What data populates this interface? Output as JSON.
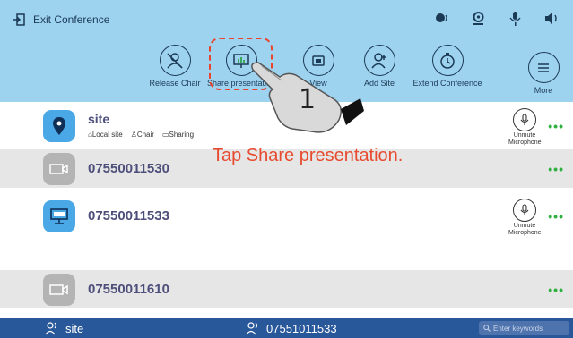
{
  "header": {
    "exit_label": "Exit Conference"
  },
  "top_icons": [
    "speaker-volume-icon",
    "camera-icon",
    "microphone-icon",
    "volume-icon"
  ],
  "toolbar": {
    "release_chair": "Release Chair",
    "share_presentation": "Share presentation",
    "view": "View",
    "add_site": "Add Site",
    "extend_conference": "Extend Conference",
    "more": "More"
  },
  "annotation": {
    "step": "1",
    "caption": "Tap Share presentation."
  },
  "sites": [
    {
      "name": "site",
      "local_site": "Local site",
      "chair": "Chair",
      "sharing": "Sharing",
      "mic_label": "Unmute Microphone"
    },
    {
      "name": "07550011530"
    },
    {
      "name": "07550011533",
      "mic_label": "Unmute Microphone"
    },
    {
      "name": "07550011610"
    }
  ],
  "footer": {
    "speaker1": "site",
    "speaker2": "07551011533",
    "search_placeholder": "Enter keywords"
  },
  "colors": {
    "header_bg": "#9ed3f0",
    "accent_red": "#e74a2e",
    "footer_bg": "#28579a",
    "more_green": "#30b040"
  }
}
